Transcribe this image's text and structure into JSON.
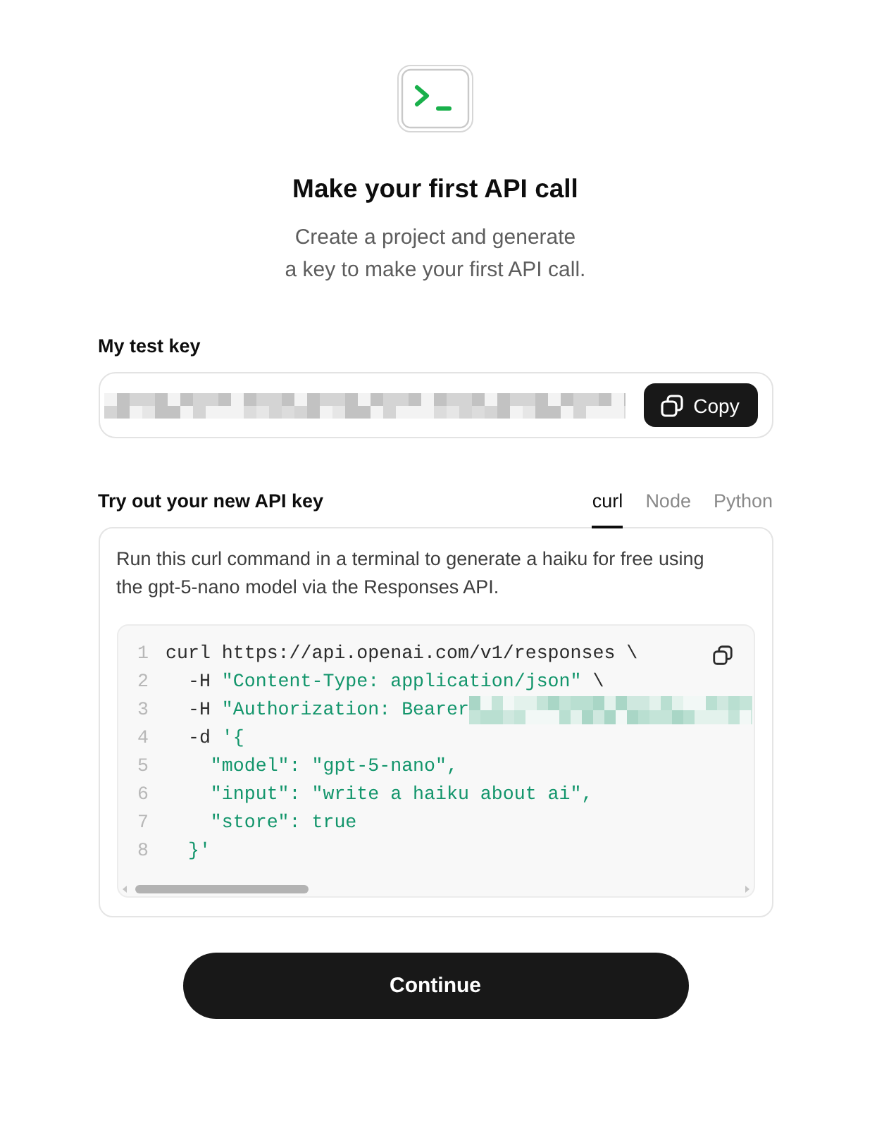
{
  "header": {
    "title": "Make your first API call",
    "subtitle": "Create a project and generate\na key to make your first API call."
  },
  "test_key": {
    "label": "My test key",
    "value_redacted": true,
    "copy_button": "Copy"
  },
  "try_out": {
    "title": "Try out your new API key",
    "tabs": [
      {
        "label": "curl",
        "selected": true
      },
      {
        "label": "Node",
        "selected": false
      },
      {
        "label": "Python",
        "selected": false
      }
    ],
    "description": "Run this curl command in a terminal to generate a haiku for free using the gpt-5-nano model via the Responses API.",
    "code_lines": [
      {
        "number": "1",
        "segments": [
          {
            "kind": "plain",
            "text": "curl https://api.openai.com/v1/responses \\"
          }
        ]
      },
      {
        "number": "2",
        "segments": [
          {
            "kind": "plain",
            "text": "  -H "
          },
          {
            "kind": "string",
            "text": "\"Content-Type: application/json\""
          },
          {
            "kind": "plain",
            "text": " \\"
          }
        ]
      },
      {
        "number": "3",
        "segments": [
          {
            "kind": "plain",
            "text": "  -H "
          },
          {
            "kind": "string",
            "text": "\"Authorization: Bearer"
          },
          {
            "kind": "redacted"
          }
        ]
      },
      {
        "number": "4",
        "segments": [
          {
            "kind": "plain",
            "text": "  -d "
          },
          {
            "kind": "string",
            "text": "'{"
          }
        ]
      },
      {
        "number": "5",
        "segments": [
          {
            "kind": "string",
            "text": "    \"model\": \"gpt-5-nano\","
          }
        ]
      },
      {
        "number": "6",
        "segments": [
          {
            "kind": "string",
            "text": "    \"input\": \"write a haiku about ai\","
          }
        ]
      },
      {
        "number": "7",
        "segments": [
          {
            "kind": "string",
            "text": "    \"store\": true"
          }
        ]
      },
      {
        "number": "8",
        "segments": [
          {
            "kind": "string",
            "text": "  }'"
          }
        ]
      }
    ]
  },
  "continue_button": "Continue"
}
